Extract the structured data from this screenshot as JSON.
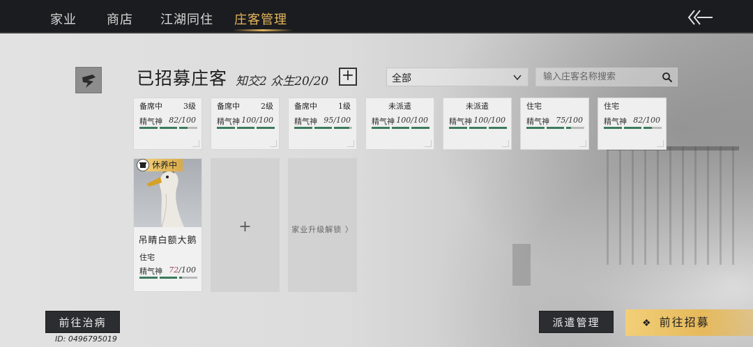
{
  "nav": {
    "tabs": [
      "家业",
      "商店",
      "江湖同住",
      "庄客管理"
    ],
    "active_tab": "庄客管理"
  },
  "header": {
    "title": "已招募庄客",
    "subinfo": "知交2 众生20/20",
    "add_symbol": "+"
  },
  "filter": {
    "selected": "全部"
  },
  "search": {
    "placeholder": "输入庄客名称搜索"
  },
  "stat_label": "精气神",
  "cards": [
    {
      "status": "备席中",
      "level": "3级",
      "value": "82/100",
      "fill": 0.82
    },
    {
      "status": "备席中",
      "level": "2级",
      "value": "100/100",
      "fill": 1.0
    },
    {
      "status": "备席中",
      "level": "1级",
      "value": "95/100",
      "fill": 0.95
    },
    {
      "status": "未派遣",
      "level": "",
      "value": "100/100",
      "fill": 1.0
    },
    {
      "status": "未派遣",
      "level": "",
      "value": "100/100",
      "fill": 1.0
    },
    {
      "status": "住宅",
      "level": "",
      "value": "75/100",
      "fill": 0.75
    },
    {
      "status": "住宅",
      "level": "",
      "value": "82/100",
      "fill": 0.82
    }
  ],
  "goose": {
    "badge": "休养中",
    "name": "吊睛白额大鹅",
    "location": "住宅",
    "value_current": "72",
    "value_max": "/100",
    "fill": 0.72
  },
  "empty_slot": {
    "symbol": "+"
  },
  "locked_slot": {
    "text": "家业升级解锁 〉"
  },
  "buttons": {
    "heal": "前往治病",
    "dispatch": "派遣管理",
    "recruit": "前往招募",
    "recruit_icon": "❖"
  },
  "user_id": "ID: 0496795019",
  "colors": {
    "accent_gold": "#e4b65c",
    "bar_fill": "#3c7a5c",
    "topbar": "#1b1c1f"
  }
}
